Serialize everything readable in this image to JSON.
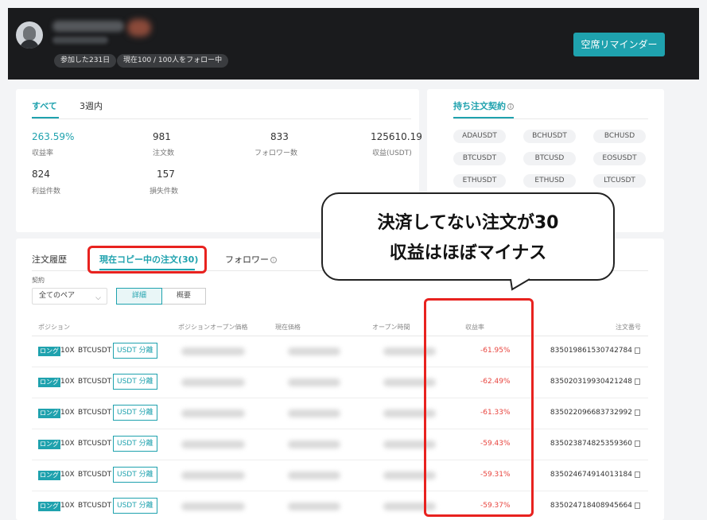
{
  "header": {
    "chips": [
      "参加した231日",
      "現在100 / 100人をフォロー中"
    ],
    "remind_button": "空席リマインダー"
  },
  "stats_card": {
    "tabs": [
      "すべて",
      "3週内"
    ],
    "stats": [
      {
        "value": "263.59%",
        "label": "収益率"
      },
      {
        "value": "981",
        "label": "注文数"
      },
      {
        "value": "833",
        "label": "フォロワー数"
      },
      {
        "value": "125610.19",
        "label": "収益(USDT)"
      },
      {
        "value": "824",
        "label": "利益件数"
      },
      {
        "value": "157",
        "label": "損失件数"
      }
    ]
  },
  "contracts_card": {
    "title": "持ち注文契約",
    "pairs": [
      "ADAUSDT",
      "BCHUSDT",
      "BCHUSD",
      "BTCUSDT",
      "BTCUSD",
      "EOSUSDT",
      "ETHUSDT",
      "ETHUSD",
      "LTCUSDT"
    ]
  },
  "orders": {
    "tabs": [
      "注文履歴",
      "現在コピー中の注文(30)",
      "フォロワー"
    ],
    "filter_label": "契約",
    "select_value": "全てのペア",
    "view_toggle": [
      "詳細",
      "概要"
    ],
    "columns": [
      "ポジション",
      "ポジションオープン価格",
      "現在価格",
      "オープン時間",
      "収益率",
      "注文番号"
    ],
    "rows": [
      {
        "side": "ロング",
        "leverage": "10X",
        "symbol": "BTCUSDT",
        "margin": "USDT 分離",
        "pnl": "-61.95%",
        "order_no": "835019861530742784"
      },
      {
        "side": "ロング",
        "leverage": "10X",
        "symbol": "BTCUSDT",
        "margin": "USDT 分離",
        "pnl": "-62.49%",
        "order_no": "835020319930421248"
      },
      {
        "side": "ロング",
        "leverage": "10X",
        "symbol": "BTCUSDT",
        "margin": "USDT 分離",
        "pnl": "-61.33%",
        "order_no": "835022096683732992"
      },
      {
        "side": "ロング",
        "leverage": "10X",
        "symbol": "BTCUSDT",
        "margin": "USDT 分離",
        "pnl": "-59.43%",
        "order_no": "835023874825359360"
      },
      {
        "side": "ロング",
        "leverage": "10X",
        "symbol": "BTCUSDT",
        "margin": "USDT 分離",
        "pnl": "-59.31%",
        "order_no": "835024674914013184"
      },
      {
        "side": "ロング",
        "leverage": "10X",
        "symbol": "BTCUSDT",
        "margin": "USDT 分離",
        "pnl": "-59.37%",
        "order_no": "835024718408945664"
      }
    ]
  },
  "annotation": {
    "lines": [
      "決済してない注文が30",
      "収益はほぼマイナス"
    ],
    "box_color": "#e8221f"
  },
  "colors": {
    "accent": "#1fa2ae",
    "loss": "#e8443e",
    "header_bg": "#1a1b1d"
  }
}
